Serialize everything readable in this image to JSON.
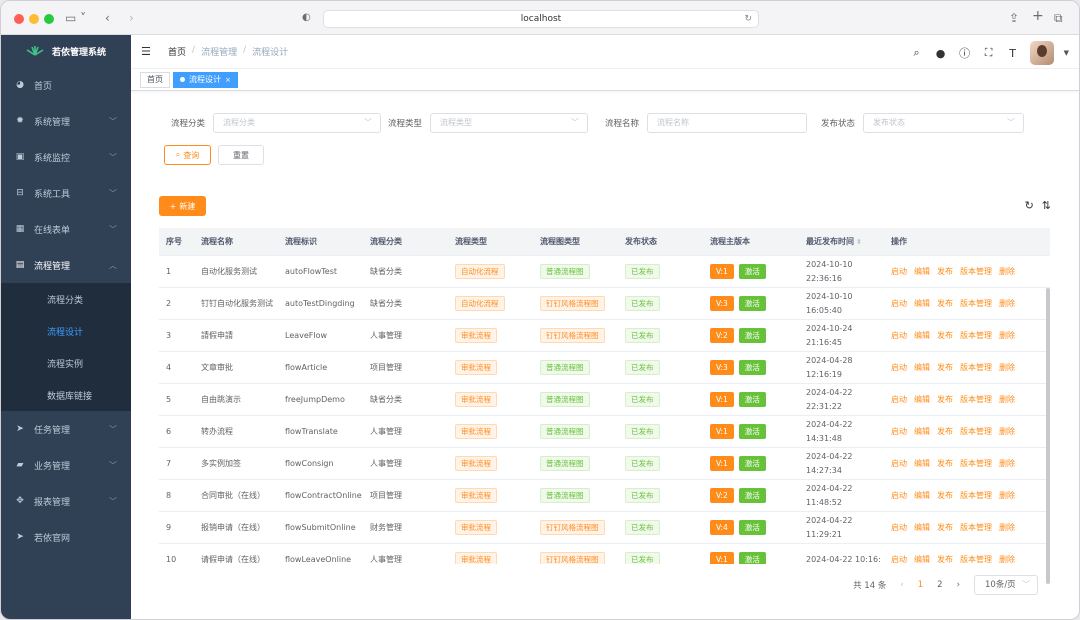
{
  "browser": {
    "url": "localhost"
  },
  "sidebar": {
    "logo": "若依管理系统",
    "items": [
      {
        "label": "首页",
        "icon": "dashboard-icon"
      },
      {
        "label": "系统管理",
        "icon": "gear-icon"
      },
      {
        "label": "系统监控",
        "icon": "monitor-icon"
      },
      {
        "label": "系统工具",
        "icon": "toolbox-icon"
      },
      {
        "label": "在线表单",
        "icon": "table-icon"
      },
      {
        "label": "流程管理",
        "icon": "document-icon"
      }
    ],
    "submenu": [
      {
        "label": "流程分类"
      },
      {
        "label": "流程设计"
      },
      {
        "label": "流程实例"
      },
      {
        "label": "数据库链接"
      }
    ],
    "items_after": [
      {
        "label": "任务管理",
        "icon": "send-icon"
      },
      {
        "label": "业务管理",
        "icon": "lock-icon"
      },
      {
        "label": "报表管理",
        "icon": "move-icon"
      },
      {
        "label": "若依官网",
        "icon": "send-icon"
      }
    ]
  },
  "navbar": {
    "breadcrumb": [
      "首页",
      "/",
      "流程管理",
      "/",
      "流程设计"
    ]
  },
  "tags": [
    {
      "label": "首页"
    },
    {
      "label": "流程设计"
    }
  ],
  "filters": {
    "category": {
      "label": "流程分类",
      "placeholder": "流程分类"
    },
    "type": {
      "label": "流程类型",
      "placeholder": "流程类型"
    },
    "name": {
      "label": "流程名称",
      "placeholder": "流程名称"
    },
    "status": {
      "label": "发布状态",
      "placeholder": "发布状态"
    },
    "query_label": "查询",
    "reset_label": "重置"
  },
  "toolbar": {
    "new_label": "新建"
  },
  "table": {
    "headers": [
      "序号",
      "流程名称",
      "流程标识",
      "流程分类",
      "流程类型",
      "流程图类型",
      "发布状态",
      "流程主版本",
      "最近发布时间",
      "操作"
    ],
    "activate_label": "激活",
    "ops": [
      "启动",
      "编辑",
      "发布",
      "版本管理",
      "删除"
    ],
    "rows": [
      {
        "no": "1",
        "name": "自动化服务测试",
        "key": "autoFlowTest",
        "category": "缺省分类",
        "type": "自动化流程",
        "chart_type": "普通流程图",
        "status": "已发布",
        "version": "V:1",
        "time": "2024-10-10 22:36:16",
        "type_color": "orange",
        "chart_color": "green"
      },
      {
        "no": "2",
        "name": "钉钉自动化服务测试",
        "key": "autoTestDingding",
        "category": "缺省分类",
        "type": "自动化流程",
        "chart_type": "钉钉风格流程图",
        "status": "已发布",
        "version": "V:3",
        "time": "2024-10-10 16:05:40",
        "type_color": "orange",
        "chart_color": "orange"
      },
      {
        "no": "3",
        "name": "請假申請",
        "key": "LeaveFlow",
        "category": "人事管理",
        "type": "审批流程",
        "chart_type": "钉钉风格流程图",
        "status": "已发布",
        "version": "V:2",
        "time": "2024-10-24 21:16:45",
        "type_color": "orange",
        "chart_color": "orange"
      },
      {
        "no": "4",
        "name": "文章审批",
        "key": "flowArticle",
        "category": "项目管理",
        "type": "审批流程",
        "chart_type": "普通流程图",
        "status": "已发布",
        "version": "V:3",
        "time": "2024-04-28 12:16:19",
        "type_color": "orange",
        "chart_color": "green"
      },
      {
        "no": "5",
        "name": "自由跳演示",
        "key": "freeJumpDemo",
        "category": "缺省分类",
        "type": "审批流程",
        "chart_type": "普通流程图",
        "status": "已发布",
        "version": "V:1",
        "time": "2024-04-22 22:31:22",
        "type_color": "orange",
        "chart_color": "green"
      },
      {
        "no": "6",
        "name": "转办流程",
        "key": "flowTranslate",
        "category": "人事管理",
        "type": "审批流程",
        "chart_type": "普通流程图",
        "status": "已发布",
        "version": "V:1",
        "time": "2024-04-22 14:31:48",
        "type_color": "orange",
        "chart_color": "green"
      },
      {
        "no": "7",
        "name": "多实例加签",
        "key": "flowConsign",
        "category": "人事管理",
        "type": "审批流程",
        "chart_type": "普通流程图",
        "status": "已发布",
        "version": "V:1",
        "time": "2024-04-22 14:27:34",
        "type_color": "orange",
        "chart_color": "green"
      },
      {
        "no": "8",
        "name": "合同审批（在线）",
        "key": "flowContractOnline",
        "category": "项目管理",
        "type": "审批流程",
        "chart_type": "普通流程图",
        "status": "已发布",
        "version": "V:2",
        "time": "2024-04-22 11:48:52",
        "type_color": "orange",
        "chart_color": "green"
      },
      {
        "no": "9",
        "name": "报销申请（在线）",
        "key": "flowSubmitOnline",
        "category": "财务管理",
        "type": "审批流程",
        "chart_type": "钉钉风格流程图",
        "status": "已发布",
        "version": "V:4",
        "time": "2024-04-22 11:29:21",
        "type_color": "orange",
        "chart_color": "orange"
      },
      {
        "no": "10",
        "name": "请假申请（在线）",
        "key": "flowLeaveOnline",
        "category": "人事管理",
        "type": "审批流程",
        "chart_type": "钉钉风格流程图",
        "status": "已发布",
        "version": "V:1",
        "time": "2024-04-22 10:16:",
        "type_color": "orange",
        "chart_color": "orange"
      }
    ]
  },
  "pagination": {
    "total": "共 14 条",
    "pages": [
      "1",
      "2"
    ],
    "page_size": "10条/页"
  },
  "colors": {
    "accent": "#ff8c1a",
    "success": "#67c23a",
    "sidebar": "#304156",
    "link": "#409eff"
  }
}
